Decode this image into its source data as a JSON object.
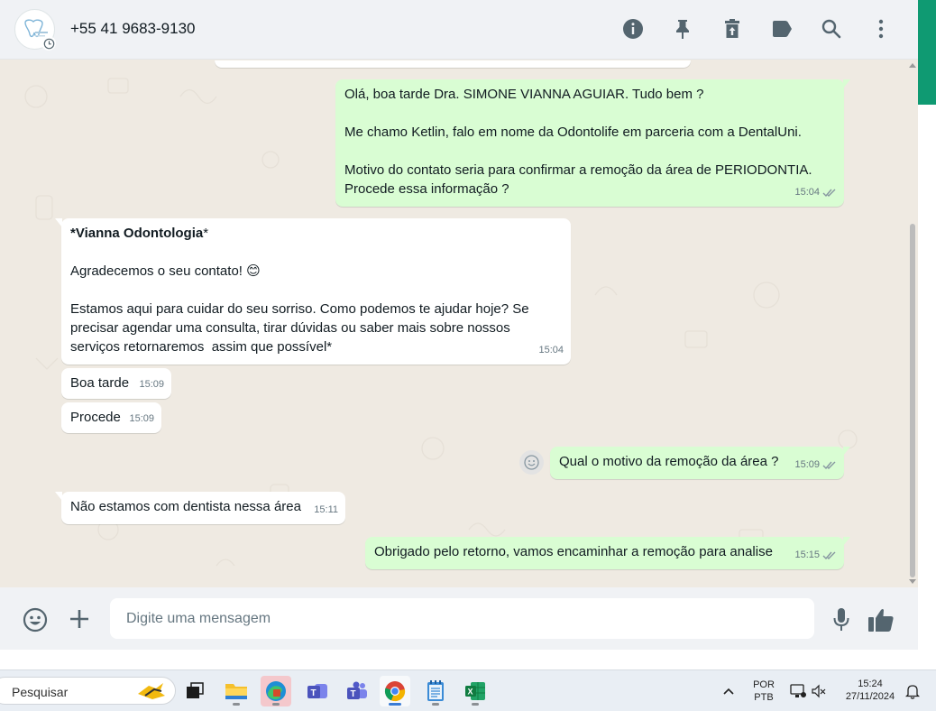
{
  "header": {
    "contact_name": "+55 41 9683-9130",
    "icons": [
      "info-icon",
      "pin-icon",
      "delete-icon",
      "label-icon",
      "search-icon",
      "more-options-icon"
    ]
  },
  "messages": [
    {
      "direction": "outgoing",
      "lines": [
        "Olá, boa tarde Dra. SIMONE VIANNA AGUIAR. Tudo bem ?",
        "",
        "Me chamo Ketlin, falo em nome da Odontolife em parceria com a DentalUni.",
        "",
        "Motivo do contato seria para confirmar a remoção da área de PERIODONTIA.",
        "Procede essa informação ?"
      ],
      "time": "15:04",
      "status": "read"
    },
    {
      "direction": "incoming",
      "title_bold": "*Vianna Odontologia",
      "title_rest": "*",
      "lines": [
        "",
        "Agradecemos o seu contato! 😊",
        "",
        "Estamos aqui para cuidar do seu sorriso. Como podemos te ajudar hoje? Se",
        "precisar agendar uma consulta, tirar dúvidas ou saber mais sobre nossos",
        "serviços retornaremos  assim que possível*"
      ],
      "time": "15:04"
    },
    {
      "direction": "incoming",
      "text": "Boa tarde",
      "time": "15:09"
    },
    {
      "direction": "incoming",
      "text": "Procede",
      "time": "15:09"
    },
    {
      "direction": "outgoing",
      "text": "Qual o motivo da remoção da área ?",
      "time": "15:09",
      "status": "read"
    },
    {
      "direction": "incoming",
      "text": "Não estamos com dentista nessa área",
      "time": "15:11"
    },
    {
      "direction": "outgoing",
      "text": "Obrigado pelo retorno, vamos encaminhar a remoção para analise",
      "time": "15:15",
      "status": "read"
    }
  ],
  "composer": {
    "placeholder": "Digite uma mensagem",
    "value": ""
  },
  "taskbar": {
    "search_placeholder": "Pesquisar",
    "apps": [
      "file-explorer",
      "edge",
      "teams",
      "teams-classic",
      "chrome",
      "notepad",
      "excel"
    ],
    "language_line1": "POR",
    "language_line2": "PTB",
    "time": "15:24",
    "date": "27/11/2024"
  },
  "colors": {
    "outgoing_bubble": "#d9fdd3",
    "incoming_bubble": "#ffffff",
    "chat_background": "#efeae2",
    "read_ticks": "#53bdeb",
    "accent_green": "#0f9a72"
  }
}
